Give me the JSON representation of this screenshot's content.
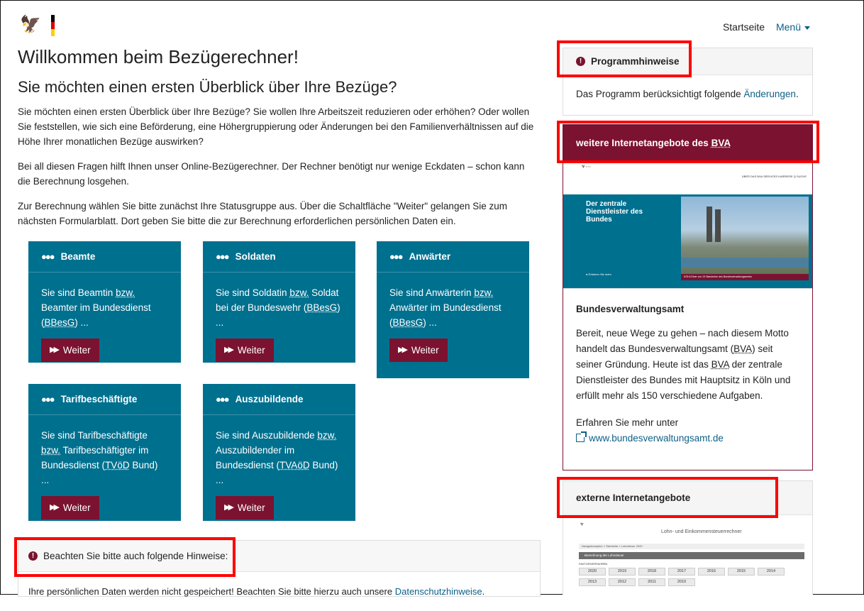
{
  "header": {
    "home_link": "Startseite",
    "menu_link": "Menü"
  },
  "main": {
    "title": "Willkommen beim Bezügerechner!",
    "subtitle": "Sie möchten einen ersten Überblick über Ihre Bezüge?",
    "intro": "Sie möchten einen ersten Überblick über Ihre Bezüge? Sie wollen Ihre Arbeitszeit reduzieren oder erhöhen? Oder wollen Sie feststellen, wie sich eine Beförderung, eine Höhergruppierung oder Änderungen bei den Familienverhältnissen auf die Höhe Ihrer monatlichen Bezüge auswirken?",
    "para2": "Bei all diesen Fragen hilft Ihnen unser Online-Bezügerechner. Der Rechner benötigt nur wenige Eckdaten – schon kann die Berechnung losgehen.",
    "para3": "Zur Berechnung wählen Sie bitte zunächst Ihre Statusgruppe aus. Über die Schaltfläche \"Weiter\" gelangen Sie zum nächsten Formularblatt. Dort geben Sie bitte die zur Berechnung erforderlichen persönlichen Daten ein."
  },
  "cards": {
    "weiter_label": "Weiter",
    "beamte": {
      "title": "Beamte",
      "t1": "Sie sind Beamtin ",
      "abbr1": "bzw.",
      "t2": " Beamter im Bundesdienst (",
      "abbr2": "BBesG",
      "t3": ") ..."
    },
    "soldaten": {
      "title": "Soldaten",
      "t1": "Sie sind Soldatin ",
      "abbr1": "bzw.",
      "t2": " Soldat bei der Bundeswehr (",
      "abbr2": "BBesG",
      "t3": ") ..."
    },
    "anwaerter": {
      "title": "Anwärter",
      "t1": "Sie sind Anwärterin ",
      "abbr1": "bzw.",
      "t2": " Anwärter im Bundesdienst (",
      "abbr2": "BBesG",
      "t3": ") ..."
    },
    "tarif": {
      "title": "Tarifbeschäftigte",
      "t1": "Sie sind Tarifbeschäftigte ",
      "abbr1": "bzw.",
      "t2": " Tarifbeschäftigter im Bundesdienst (",
      "abbr2": "TVöD",
      "t3": " Bund) ..."
    },
    "azubi": {
      "title": "Auszubildende",
      "t1": "Sie sind Auszubildende ",
      "abbr1": "bzw.",
      "t2": " Auszubildender im Bundesdienst (",
      "abbr2": "TVAöD",
      "t3": " Bund) ..."
    }
  },
  "notice": {
    "title": "Beachten Sie bitte auch folgende Hinweise:",
    "text": "Ihre persönlichen Daten werden nicht gespeichert! Beachten Sie bitte hierzu auch unsere ",
    "link": "Datenschutzhinweise",
    "end": "."
  },
  "sidebar": {
    "program_title": "Programmhinweise",
    "program_text": "Das Programm berücksichtigt folgende ",
    "program_link": "Änderungen",
    "program_end": ".",
    "bva_title_prefix": "weitere Internetangebote des ",
    "bva_title_abbr": "BVA",
    "bva_heading": "Bundesverwaltungsamt",
    "bva_text_1": "Bereit, neue Wege zu gehen – nach diesem Motto handelt das Bundesverwaltungsamt (",
    "bva_abbr": "BVA",
    "bva_text_2": ") seit seiner Gründung. Heute ist das ",
    "bva_text_3": " der zentrale Dienstleister des Bundes mit Hauptsitz in Köln und erfüllt mehr als 150 verschiedene Aufgaben.",
    "bva_more": "Erfahren Sie mehr unter",
    "bva_link": "www.bundesverwaltungsamt.de",
    "bva_shot_title": "Der zentrale Dienstleister des Bundes",
    "bva_shot_nav": "ÜBER DAS BVA   SERVICES   KARRIERE   Q SUCHE",
    "bva_shot_more": "Erfahren Sie mehr",
    "bva_shot_caption": "KÖLN   Einer von 19 Standorten des Bundesverwaltungsamtes",
    "ext_title": "externe Internetangebote",
    "ext_shot_title": "Lohn- und Einkommensteuerrechner",
    "ext_shot_crumb": "Navigationspfad: » Startseite » Lohnsteuer 2020",
    "ext_shot_bar": "Berechnung der Lohnsteuer",
    "ext_shot_sub": "FAKTORVERFAHREN",
    "ext_years": [
      "2020",
      "2019",
      "2018",
      "2017",
      "2016",
      "2015",
      "2014",
      "2013",
      "2012",
      "2011",
      "2010"
    ]
  },
  "colors": {
    "teal": "#00708f",
    "bordeaux": "#7b1230",
    "link": "#0d5f86",
    "highlight": "#ff0000"
  }
}
